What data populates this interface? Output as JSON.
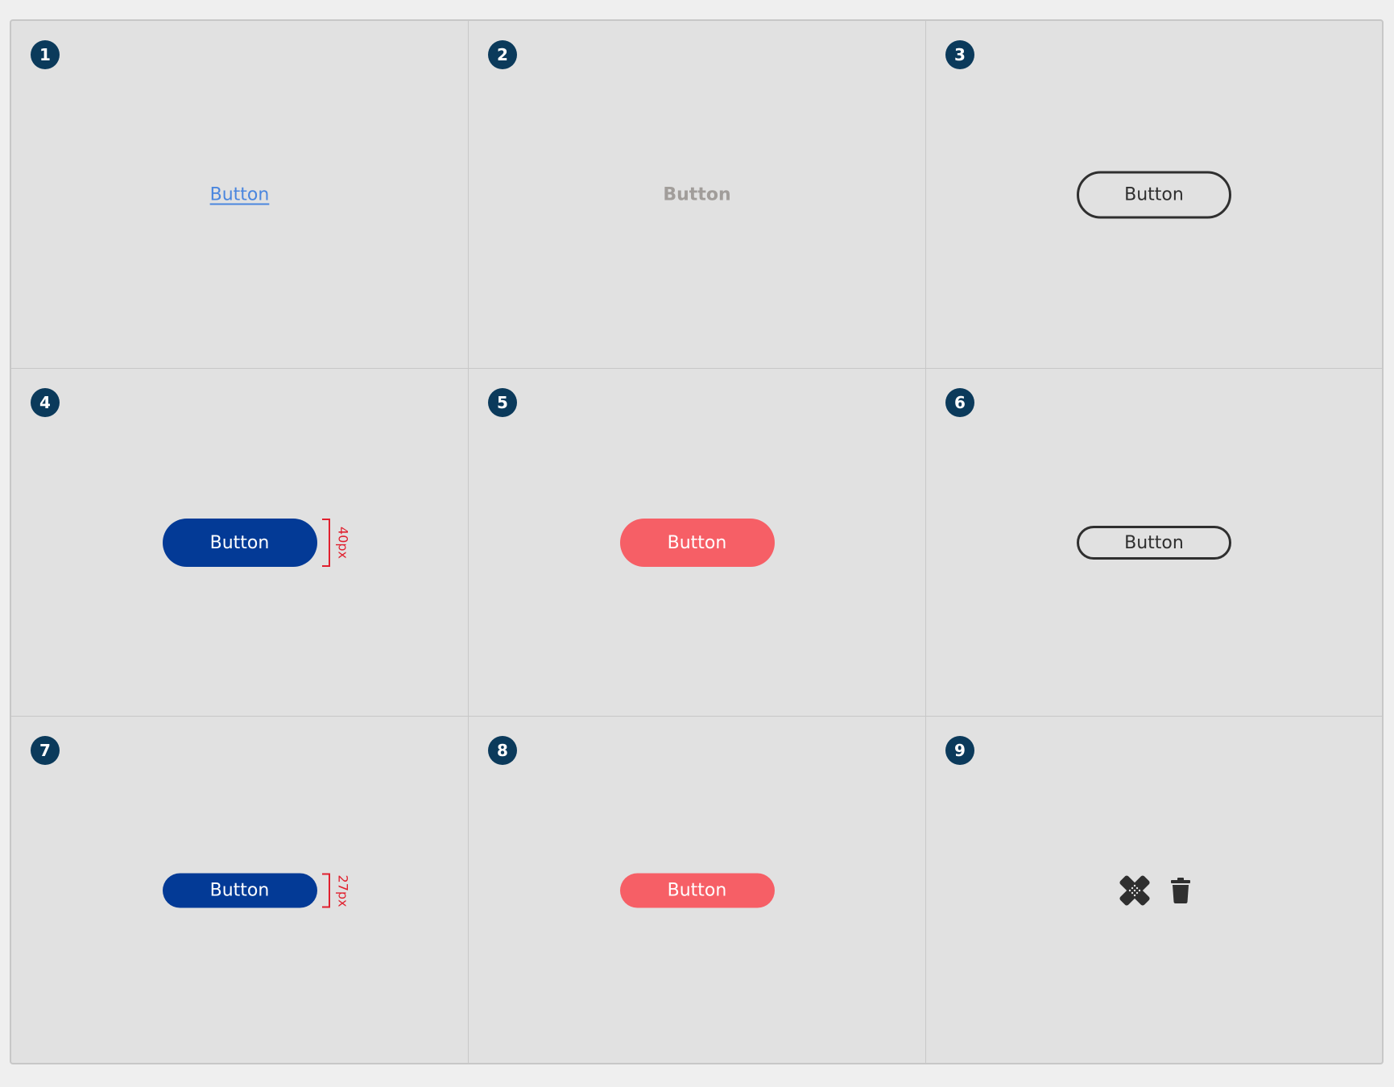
{
  "cells": [
    {
      "number": "1",
      "button_label": "Button",
      "variant": "link"
    },
    {
      "number": "2",
      "button_label": "Button",
      "variant": "ghost"
    },
    {
      "number": "3",
      "button_label": "Button",
      "variant": "outline"
    },
    {
      "number": "4",
      "button_label": "Button",
      "variant": "primary",
      "height_note": "40px"
    },
    {
      "number": "5",
      "button_label": "Button",
      "variant": "danger"
    },
    {
      "number": "6",
      "button_label": "Button",
      "variant": "outline-small"
    },
    {
      "number": "7",
      "button_label": "Button",
      "variant": "primary-small",
      "height_note": "27px"
    },
    {
      "number": "8",
      "button_label": "Button",
      "variant": "danger-small"
    },
    {
      "number": "9",
      "icons": [
        "bandage-icon",
        "trash-icon"
      ],
      "variant": "icon-buttons"
    }
  ],
  "colors": {
    "badge": "#0b3a5b",
    "link": "#4a86de",
    "ghost": "#a19d9a",
    "outline": "#2f2f2f",
    "primary": "#033a96",
    "danger": "#f65f66",
    "measure": "#e0202e",
    "panel": "#e1e1e1"
  }
}
